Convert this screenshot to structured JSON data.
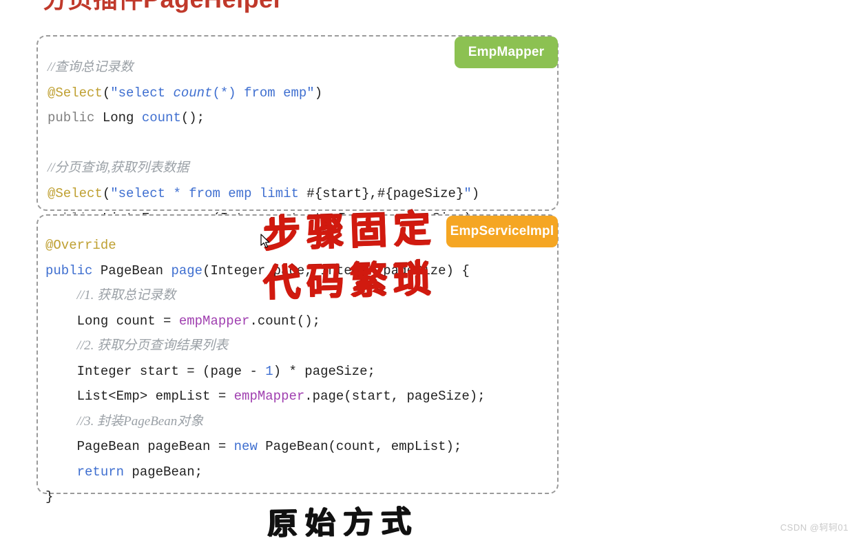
{
  "slide": {
    "title": "分页插件PageHelper",
    "title_color": "#c0392b",
    "background": "#ffffff"
  },
  "mapper_box": {
    "badge": {
      "label": "EmpMapper",
      "color": "#8cc152"
    },
    "lines": [
      {
        "id": "m1",
        "text": "//查询总记录数"
      },
      {
        "id": "m2",
        "text": "@Select(\"select count(*) from emp\")"
      },
      {
        "id": "m3",
        "text": "public Long count();"
      },
      {
        "id": "m4",
        "text": ""
      },
      {
        "id": "m5",
        "text": "//分页查询,获取列表数据"
      },
      {
        "id": "m6",
        "text": "@Select(\"select * from emp limit #{start},#{pageSize}\")"
      },
      {
        "id": "m7",
        "text": "public List<Emp> page(Integer start, Integer pageSize);"
      }
    ]
  },
  "service_box": {
    "badge": {
      "label": "EmpServiceImpl",
      "color": "#f5a623"
    },
    "lines": [
      {
        "id": "s1",
        "text": "@Override"
      },
      {
        "id": "s2",
        "text": "public PageBean page(Integer page, Integer pageSize) {"
      },
      {
        "id": "s3",
        "text": "    //1. 获取总记录数"
      },
      {
        "id": "s4",
        "text": "    Long count = empMapper.count();"
      },
      {
        "id": "s5",
        "text": "    //2. 获取分页查询结果列表"
      },
      {
        "id": "s6",
        "text": "    Integer start = (page - 1) * pageSize;"
      },
      {
        "id": "s7",
        "text": "    List<Emp> empList = empMapper.page(start, pageSize);"
      },
      {
        "id": "s8",
        "text": "    //3. 封装PageBean对象"
      },
      {
        "id": "s9",
        "text": "    PageBean pageBean = new PageBean(count, empList);"
      },
      {
        "id": "s10",
        "text": "    return pageBean;"
      },
      {
        "id": "s11",
        "text": "}"
      }
    ]
  },
  "annotations": {
    "overlay_top": "步骤固定",
    "overlay_bottom": "代码繁琐",
    "overlay_color": "#d11a0f",
    "caption": "原始方式",
    "caption_color": "#111111"
  },
  "watermark": {
    "text": "CSDN @轲轲01"
  }
}
